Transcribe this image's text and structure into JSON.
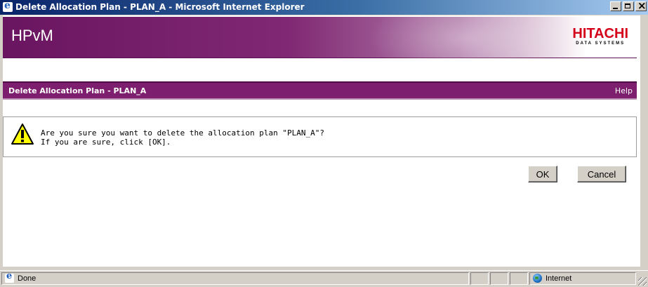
{
  "window": {
    "title": "Delete Allocation Plan - PLAN_A - Microsoft Internet Explorer",
    "icon": "ie-icon"
  },
  "banner": {
    "app_name": "HPvM",
    "logo_main": "HITACHI",
    "logo_sub": "DATA SYSTEMS"
  },
  "header": {
    "title": "Delete Allocation Plan - PLAN_A",
    "help": "Help"
  },
  "message": {
    "icon": "warning-icon",
    "line1": "Are you sure you want to delete the allocation plan \"PLAN_A\"?",
    "line2": "If you are sure, click [OK]."
  },
  "buttons": {
    "ok": "OK",
    "cancel": "Cancel"
  },
  "statusbar": {
    "status": "Done",
    "zone": "Internet"
  },
  "colors": {
    "banner": "#802873",
    "header_bar": "#7e1e6e",
    "logo_red": "#d4001a"
  }
}
